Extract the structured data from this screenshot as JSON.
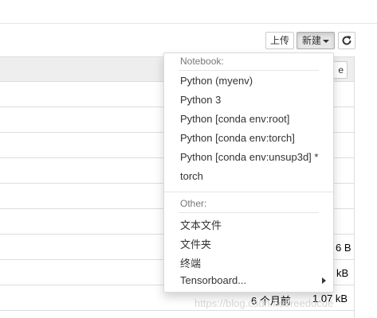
{
  "toolbar": {
    "upload_label": "上传",
    "new_label": "新建",
    "refresh_icon": "refresh-icon"
  },
  "list_header": {
    "button_partial_label": "e"
  },
  "rows": {
    "sizes": [
      "6 B",
      "kB",
      "1.07 kB"
    ],
    "last_modified": "6 个月前"
  },
  "new_menu": {
    "notebook_header": "Notebook:",
    "notebook_items": [
      "Python (myenv)",
      "Python 3",
      "Python [conda env:root]",
      "Python [conda env:torch]",
      "Python [conda env:unsup3d] *",
      "torch"
    ],
    "other_header": "Other:",
    "other_items": [
      "文本文件",
      "文件夹",
      "终端",
      "Tensorboard..."
    ]
  },
  "watermark": "https://blog.csdn.net/reeducue",
  "colors": {
    "menu_text": "#333333",
    "menu_header": "#777777",
    "border": "#dddddd"
  }
}
